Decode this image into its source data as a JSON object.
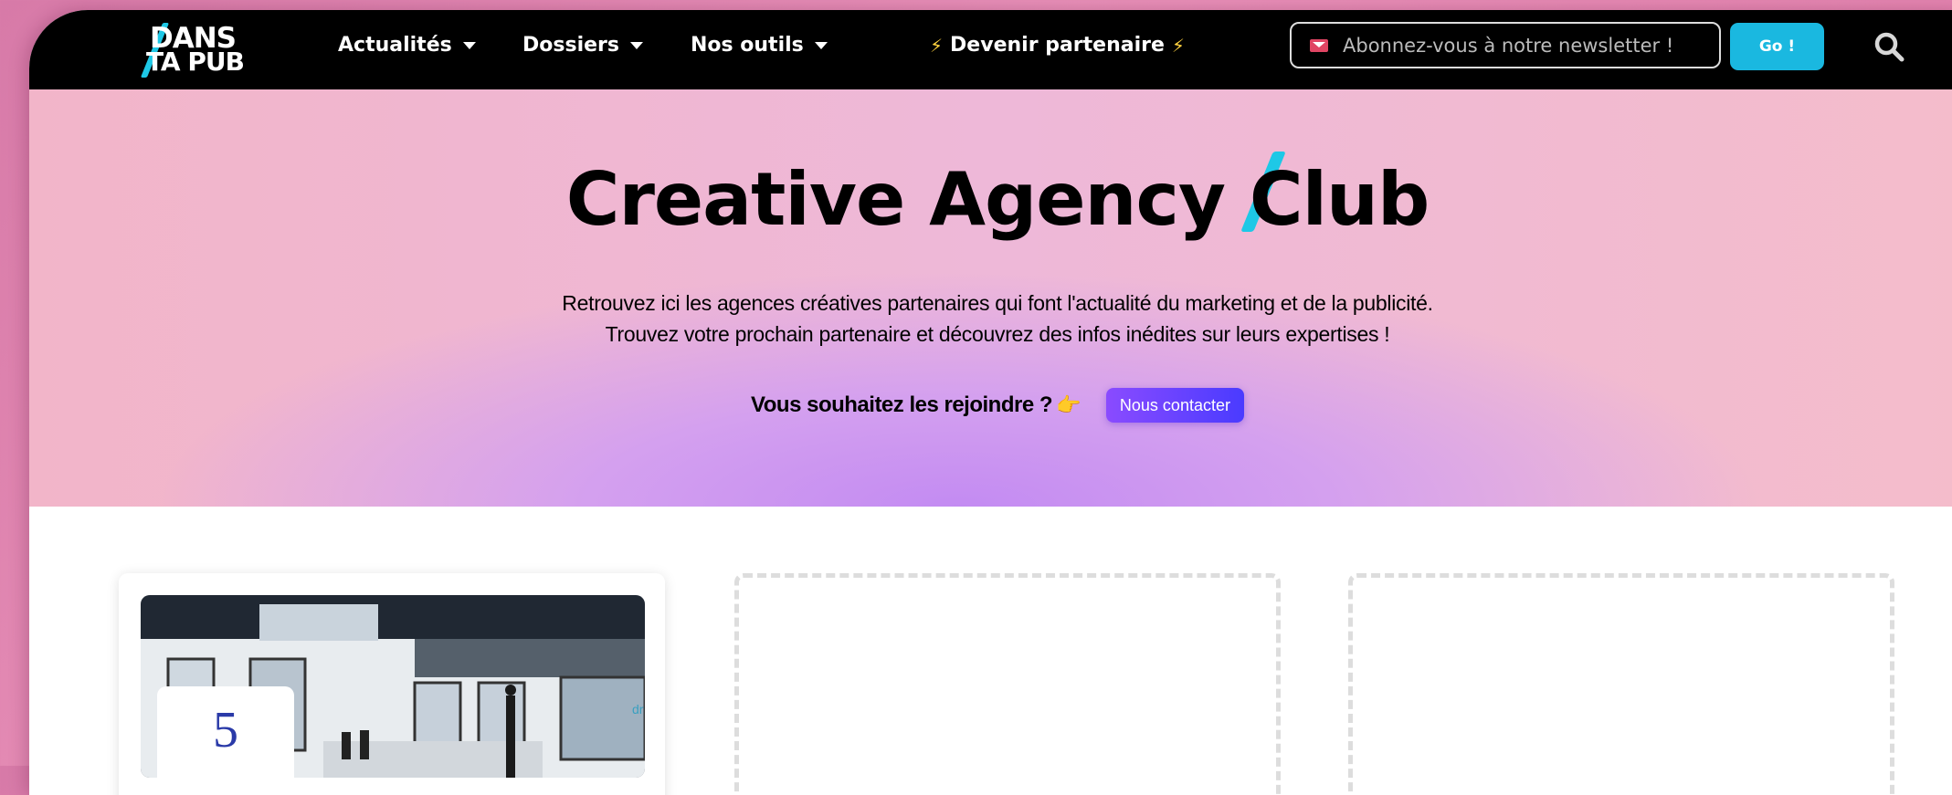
{
  "navbar": {
    "logo": {
      "line1": "DANS",
      "line2": "TA PUB"
    },
    "menu": [
      {
        "label": "Actualités"
      },
      {
        "label": "Dossiers"
      },
      {
        "label": "Nos outils"
      }
    ],
    "partner_label": "Devenir partenaire",
    "newsletter_placeholder": "Abonnez-vous à notre newsletter !",
    "go_label": "Go !",
    "icons": [
      "envelope-icon",
      "search-icon",
      "bolt-icon",
      "chevron-down-icon"
    ]
  },
  "hero": {
    "title": "Creative Agency Club",
    "desc_line1": "Retrouvez ici les agences créatives partenaires qui font l'actualité du marketing et de la publicité.",
    "desc_line2": "Trouvez votre prochain partenaire et découvrez des infos inédites sur leurs expertises !",
    "join_text": "Vous souhaitez les rejoindre ?",
    "contact_label": "Nous contacter"
  },
  "cards": [
    {
      "badge": "5",
      "img_label": "dr"
    }
  ],
  "colors": {
    "accent_cyan": "#1ec8e6",
    "go_button": "#1ab8e0",
    "contact_gradient_start": "#8a4bff",
    "contact_gradient_end": "#4a3bff",
    "navbar_bg": "#000000"
  }
}
